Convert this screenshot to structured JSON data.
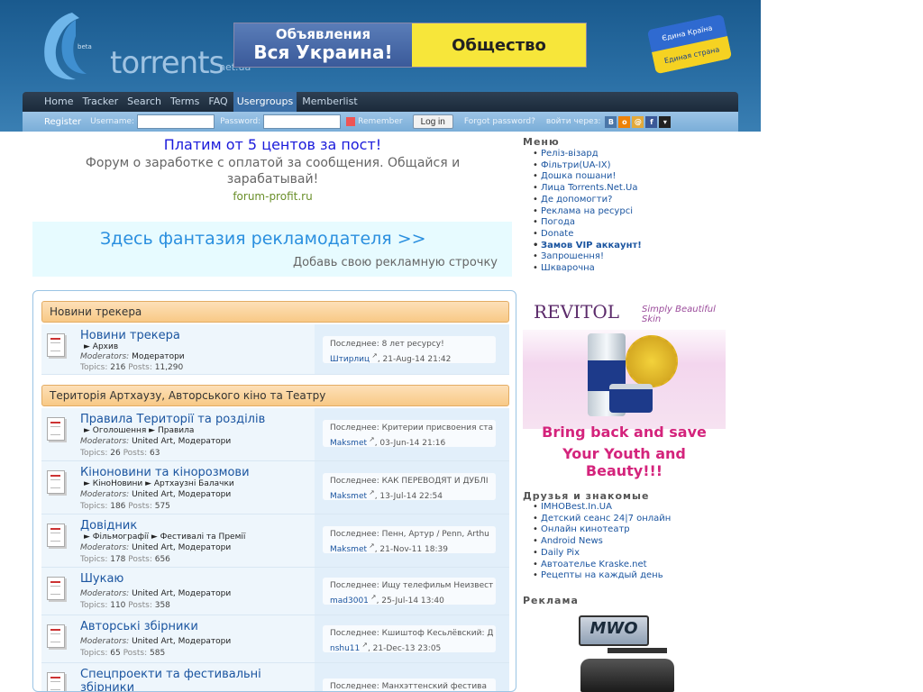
{
  "header": {
    "logo": {
      "beta": "beta",
      "brand": "torrents",
      "tld": "net.ua"
    },
    "banner": {
      "left_line1": "Объявления",
      "left_line2": "Вся Украина!",
      "right": "Общество"
    },
    "flag": {
      "top": "Єдина Країна",
      "bottom": "Единая страна"
    }
  },
  "nav": {
    "items": [
      "Home",
      "Tracker",
      "Search",
      "Terms",
      "FAQ",
      "Usergroups",
      "Memberlist"
    ],
    "active": "Usergroups"
  },
  "login": {
    "register": "Register",
    "username_label": "Username:",
    "password_label": "Password:",
    "remember_label": "Remember",
    "login_button": "Log in",
    "forgot": "Forgot password?",
    "via": "войти через:"
  },
  "promo1": {
    "title": "Платим от 5 центов за пост!",
    "desc": "Форум о заработке с оплатой за сообщения. Общайся и зарабатывай!",
    "url": "forum-profit.ru"
  },
  "promo2": {
    "title": "Здесь фантазия рекламодателя >>",
    "sub": "Добавь свою рекламную строчку"
  },
  "forum": {
    "cat1": "Новини трекера",
    "cat2": "Територія Артхаузу, Авторського кіно та Театру",
    "rows": [
      {
        "title": "Новини трекера",
        "sub": "► Архив",
        "mods_label": "Moderators:",
        "mods": "Модератори",
        "topics_label": "Topics:",
        "topics": "216",
        "posts_label": "Posts:",
        "posts": "11,290",
        "last_label": "Последнее:",
        "last_title": "8 лет ресурсу!",
        "last_user": "Штирлиц",
        "last_date": ", 21-Aug-14 21:42"
      },
      {
        "title": "Правила Території та розділів",
        "sub": "► Оголошення  ► Правила",
        "mods_label": "Moderators:",
        "mods": "United Art, Модератори",
        "topics_label": "Topics:",
        "topics": "26",
        "posts_label": "Posts:",
        "posts": "63",
        "last_label": "Последнее:",
        "last_title": "Критерии присвоения ста",
        "last_user": "Maksmet",
        "last_date": ", 03-Jun-14 21:16"
      },
      {
        "title": "Кіноновини та кінорозмови",
        "sub": "► КіноНовини  ► Артхаузні Балачки",
        "mods_label": "Moderators:",
        "mods": "United Art, Модератори",
        "topics_label": "Topics:",
        "topics": "186",
        "posts_label": "Posts:",
        "posts": "575",
        "last_label": "Последнее:",
        "last_title": "КАК ПЕРЕВОДЯТ И ДУБЛІ",
        "last_user": "Maksmet",
        "last_date": ", 13-Jul-14 22:54"
      },
      {
        "title": "Довідник",
        "sub": "► Фільмографії  ► Фестивалі та Премії",
        "mods_label": "Moderators:",
        "mods": "United Art, Модератори",
        "topics_label": "Topics:",
        "topics": "178",
        "posts_label": "Posts:",
        "posts": "656",
        "last_label": "Последнее:",
        "last_title": "Пенн, Артур / Penn, Arthu",
        "last_user": "Maksmet",
        "last_date": ", 21-Nov-11 18:39"
      },
      {
        "title": "Шукаю",
        "sub": "",
        "mods_label": "Moderators:",
        "mods": "United Art, Модератори",
        "topics_label": "Topics:",
        "topics": "110",
        "posts_label": "Posts:",
        "posts": "358",
        "last_label": "Последнее:",
        "last_title": "Ищу телефильм Неизвест",
        "last_user": "mad3001",
        "last_date": ", 25-Jul-14 13:40"
      },
      {
        "title": "Авторські збірники",
        "sub": "",
        "mods_label": "Moderators:",
        "mods": "United Art, Модератори",
        "topics_label": "Topics:",
        "topics": "65",
        "posts_label": "Posts:",
        "posts": "585",
        "last_label": "Последнее:",
        "last_title": "Кшиштоф Кесьлёвский: Д",
        "last_user": "nshu11",
        "last_date": ", 21-Dec-13 23:05"
      },
      {
        "title": "Спецпроекти та фестивальні збірники",
        "sub": "",
        "mods_label": "",
        "mods": "",
        "topics_label": "",
        "topics": "",
        "posts_label": "",
        "posts": "",
        "last_label": "Последнее:",
        "last_title": "Манхэттенский фестива",
        "last_user": "",
        "last_date": ""
      }
    ]
  },
  "sidebar": {
    "menu_title": "Меню",
    "menu": [
      "Реліз-візард",
      "Фільтри(UA-IX)",
      "Дошка пошани!",
      "Лица Torrents.Net.Ua",
      "Де допомогти?",
      "Реклама на ресурсі",
      "Погода",
      "Donate",
      "Замов VIP аккаунт!",
      "Запрошення!",
      "Шкварочна"
    ],
    "friends_title": "Друзья и знакомые",
    "friends": [
      "IMHOBest.In.UA",
      "Детский сеанс 24|7 онлайн",
      "Онлайн кинотеатр",
      "Android News",
      "Daily Pix",
      "Автоателье Kraske.net",
      "Рецепты на каждый день"
    ],
    "ads_title": "Реклама",
    "revitol": {
      "brand": "REVITOL",
      "slogan": "Simply Beautiful Skin",
      "line1": "Bring back and save",
      "line2": "Your Youth and Beauty!!!"
    },
    "game": {
      "logo": "MWO"
    }
  },
  "colors": {
    "accent": "#1b55a0",
    "header": "#1a5a8e",
    "category": "#f8c986",
    "ad_pink": "#d4247c"
  }
}
